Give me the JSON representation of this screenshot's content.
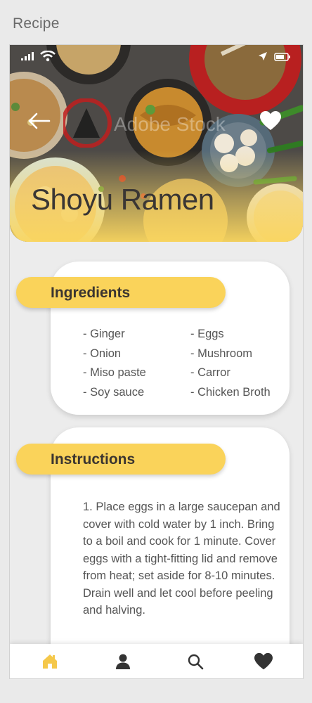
{
  "frame": {
    "title": "Recipe"
  },
  "hero": {
    "title": "Shoyu Ramen",
    "watermark_text": "Adobe Stock"
  },
  "status_bar": {
    "icons": [
      "signal-icon",
      "wifi-icon",
      "location-icon",
      "battery-icon"
    ]
  },
  "ingredients": {
    "heading": "Ingredients",
    "column1": [
      "- Ginger",
      "- Onion",
      "- Miso paste",
      "- Soy sauce"
    ],
    "column2": [
      "- Eggs",
      "- Mushroom",
      "- Carror",
      "- Chicken Broth"
    ]
  },
  "instructions": {
    "heading": "Instructions",
    "text": "1. Place eggs in a large saucepan and cover with cold water by 1 inch. Bring to a boil and cook for 1 minute. Cover eggs with a tight-fitting lid and remove from heat; set aside for 8-10 minutes. Drain well and let cool before peeling and halving."
  },
  "bottom_nav": {
    "items": [
      "home-icon",
      "profile-icon",
      "search-icon",
      "heart-icon"
    ],
    "active": "home-icon"
  },
  "colors": {
    "accent": "#fad35a",
    "active_nav": "#f5c84a",
    "text_dark": "#3b3530",
    "text_body": "#555555"
  }
}
